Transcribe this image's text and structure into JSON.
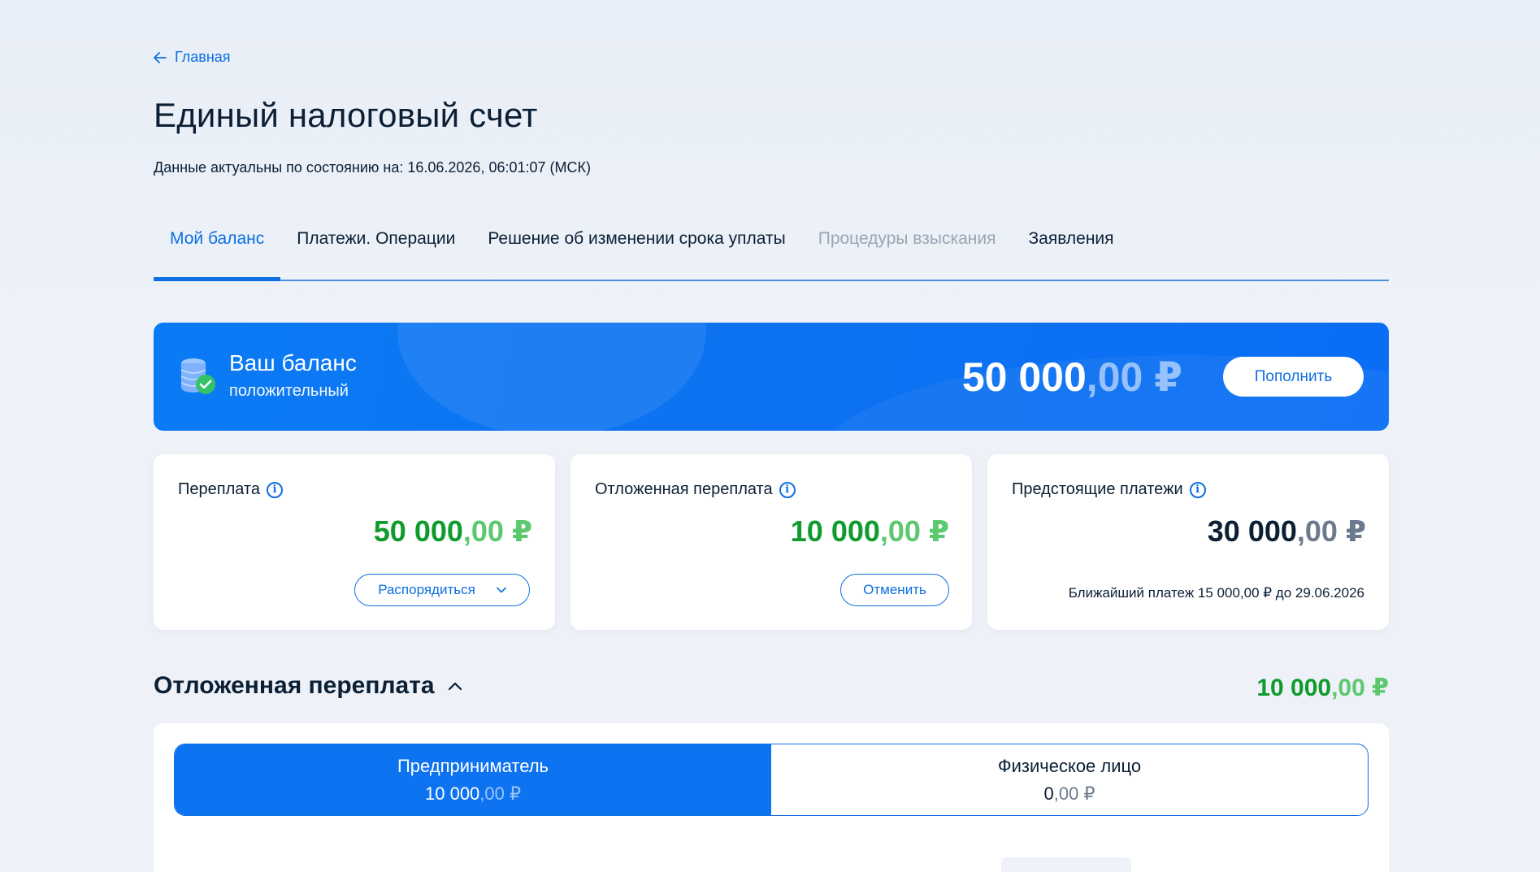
{
  "breadcrumb": {
    "back_label": "Главная"
  },
  "page": {
    "title": "Единый налоговый счет",
    "actual_label": "Данные актуальны по состоянию на: 16.06.2026, 06:01:07 (МСК)"
  },
  "tabs": [
    {
      "label": "Мой баланс",
      "state": "active"
    },
    {
      "label": "Платежи. Операции",
      "state": "normal"
    },
    {
      "label": "Решение об изменении срока уплаты",
      "state": "normal"
    },
    {
      "label": "Процедуры взыскания",
      "state": "disabled"
    },
    {
      "label": "Заявления",
      "state": "normal"
    }
  ],
  "balance": {
    "title": "Ваш баланс",
    "status": "положительный",
    "amount_int": "50 000",
    "amount_frac": ",00 ₽",
    "topup_label": "Пополнить"
  },
  "cards": {
    "overpayment": {
      "title": "Переплата",
      "amount_int": "50 000",
      "amount_frac": ",00 ₽",
      "button_label": "Распорядиться"
    },
    "deferred": {
      "title": "Отложенная переплата",
      "amount_int": "10 000",
      "amount_frac": ",00 ₽",
      "button_label": "Отменить"
    },
    "upcoming": {
      "title": "Предстоящие платежи",
      "amount_int": "30 000",
      "amount_frac": ",00 ₽",
      "next_payment": "Ближайший платеж 15 000,00 ₽ до 29.06.2026"
    }
  },
  "section": {
    "title": "Отложенная переплата",
    "amount_int": "10 000",
    "amount_frac": ",00 ₽",
    "segments": [
      {
        "label": "Предприниматель",
        "value_int": "10 000",
        "value_frac": ",00 ₽",
        "active": true
      },
      {
        "label": "Физическое лицо",
        "value_int": "0",
        "value_frac": ",00 ₽",
        "active": false
      }
    ]
  },
  "colors": {
    "accent": "#0d6fe0",
    "banner": "#0d73f0",
    "positive": "#0f9b2e",
    "text": "#0b1f35",
    "disabled": "#9aa5b4"
  },
  "icons": [
    "arrow-left-icon",
    "coins-check-icon",
    "info-icon",
    "chevron-down-icon",
    "chevron-up-icon"
  ]
}
